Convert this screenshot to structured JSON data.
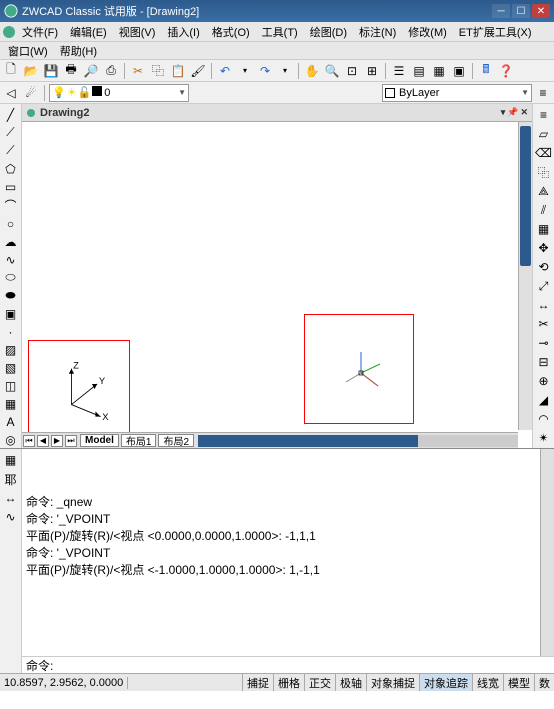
{
  "title": "ZWCAD Classic 试用版 - [Drawing2]",
  "menu1": [
    "文件(F)",
    "编辑(E)",
    "视图(V)",
    "插入(I)",
    "格式(O)",
    "工具(T)",
    "绘图(D)",
    "标注(N)",
    "修改(M)",
    "ET扩展工具(X)"
  ],
  "menu2": [
    "窗口(W)",
    "帮助(H)"
  ],
  "layer_name": "0",
  "bylayer": "ByLayer",
  "doc_tab": "Drawing2",
  "model_tabs": {
    "model": "Model",
    "l1": "布局1",
    "l2": "布局2"
  },
  "ucs": {
    "x": "X",
    "y": "Y",
    "z": "Z"
  },
  "cmd_lines": [
    "命令: _qnew",
    "命令: '_VPOINT",
    "平面(P)/旋转(R)/<视点 <0.0000,0.0000,1.0000>: -1,1,1",
    "命令: '_VPOINT",
    "平面(P)/旋转(R)/<视点 <-1.0000,1.0000,1.0000>: 1,-1,1"
  ],
  "cmd_prompt": "命令:",
  "coords": "10.8597,  2.9562,  0.0000",
  "status_btns": [
    "捕捉",
    "栅格",
    "正交",
    "极轴",
    "对象捕捉",
    "对象追踪",
    "线宽",
    "模型",
    "数"
  ],
  "status_active": "对象追踪",
  "icons": {
    "new": "📄",
    "open": "📂",
    "save": "💾",
    "print": "🖨",
    "preview": "🔍",
    "plot": "📋",
    "cut": "✂",
    "copy": "⎘",
    "paste": "📋",
    "match": "🖌",
    "undo": "↶",
    "redo": "↷",
    "pan": "✋",
    "zoomrt": "🔍",
    "zoomw": "⊡",
    "zoomp": "⊞",
    "props": "☰",
    "tool": "🔧",
    "calc": "🖩",
    "help": "?"
  },
  "left_tools": [
    "line",
    "cline",
    "pline",
    "polygon",
    "rect",
    "arc",
    "circle",
    "revcloud",
    "spline",
    "ellipse",
    "earc",
    "block",
    "point",
    "hatch",
    "grad",
    "region",
    "table",
    "mtext",
    "donut"
  ],
  "right_tools": [
    "dist",
    "area",
    "erase",
    "copy",
    "mirror",
    "offset",
    "array",
    "move",
    "rotate",
    "scale",
    "stretch",
    "trim",
    "extend",
    "break",
    "join",
    "chamfer",
    "fillet",
    "explode"
  ]
}
